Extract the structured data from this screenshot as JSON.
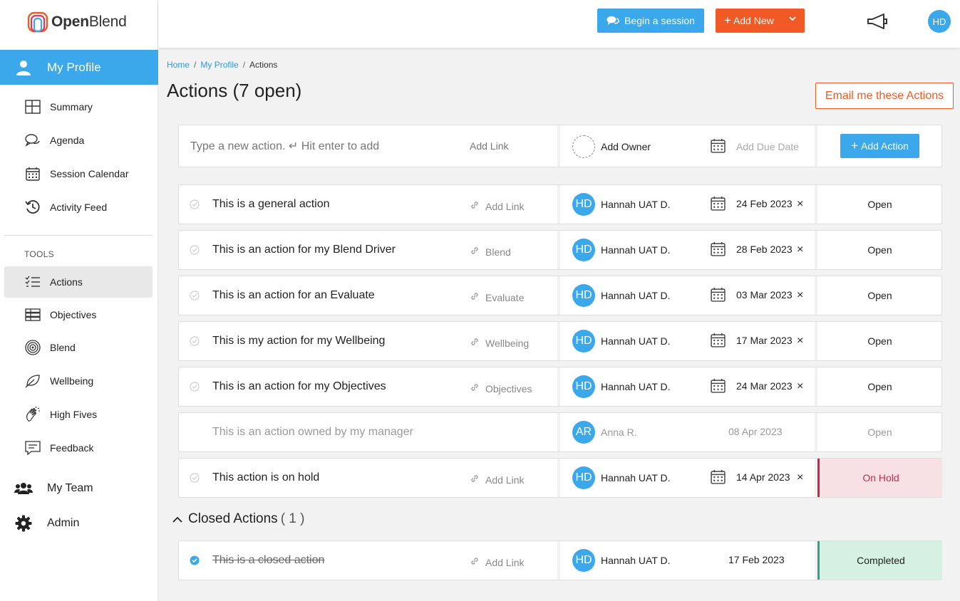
{
  "app": {
    "logo_open": "Open",
    "logo_blend": "Blend"
  },
  "sidebar": {
    "profile_label": "My Profile",
    "items": [
      {
        "label": "Summary",
        "icon": "grid-icon"
      },
      {
        "label": "Agenda",
        "icon": "chat-bubbles-icon"
      },
      {
        "label": "Session Calendar",
        "icon": "calendar-icon"
      },
      {
        "label": "Activity Feed",
        "icon": "history-icon"
      }
    ],
    "tools_label": "TOOLS",
    "tools": [
      {
        "label": "Actions",
        "icon": "checklist-icon",
        "active": true
      },
      {
        "label": "Objectives",
        "icon": "stack-icon"
      },
      {
        "label": "Blend",
        "icon": "target-icon"
      },
      {
        "label": "Wellbeing",
        "icon": "leaf-icon"
      },
      {
        "label": "High Fives",
        "icon": "clap-hands-icon"
      },
      {
        "label": "Feedback",
        "icon": "feedback-icon"
      }
    ],
    "team_label": "My Team",
    "admin_label": "Admin"
  },
  "topbar": {
    "begin_session": "Begin a session",
    "add_new": "Add New",
    "user_initials": "HD"
  },
  "breadcrumb": {
    "home": "Home",
    "profile": "My Profile",
    "current": "Actions",
    "separator": "/"
  },
  "page": {
    "title": "Actions (7 open)",
    "email_button": "Email me these Actions"
  },
  "new_action": {
    "placeholder": "Type a new action. ↵ Hit enter to add",
    "add_link": "Add Link",
    "add_owner": "Add Owner",
    "add_due_date": "Add Due Date",
    "add_action_button": "Add Action"
  },
  "actions": [
    {
      "title": "This is a general action",
      "link": "Add Link",
      "initials": "HD",
      "owner": "Hannah UAT D.",
      "date": "24 Feb 2023",
      "status": "Open"
    },
    {
      "title": "This is an action for my Blend Driver",
      "link": "Blend",
      "initials": "HD",
      "owner": "Hannah UAT D.",
      "date": "28 Feb 2023",
      "status": "Open"
    },
    {
      "title": "This is an action for an Evaluate",
      "link": "Evaluate",
      "initials": "HD",
      "owner": "Hannah UAT D.",
      "date": "03 Mar 2023",
      "status": "Open"
    },
    {
      "title": "This is my action for my Wellbeing",
      "link": "Wellbeing",
      "initials": "HD",
      "owner": "Hannah UAT D.",
      "date": "17 Mar 2023",
      "status": "Open"
    },
    {
      "title": "This is an action for my Objectives",
      "link": "Objectives",
      "initials": "HD",
      "owner": "Hannah UAT D.",
      "date": "24 Mar 2023",
      "status": "Open"
    },
    {
      "title": "This is an action owned by my manager",
      "link": "",
      "initials": "AR",
      "owner": "Anna R.",
      "date": "08 Apr 2023",
      "status": "Open"
    },
    {
      "title": "This action is on hold",
      "link": "Add Link",
      "initials": "HD",
      "owner": "Hannah UAT D.",
      "date": "14 Apr 2023",
      "status": "On Hold"
    }
  ],
  "closed": {
    "label": "Closed Actions",
    "count": "( 1 )",
    "items": [
      {
        "title": "This is a closed action",
        "link": "Add Link",
        "initials": "HD",
        "owner": "Hannah UAT D.",
        "date": "17 Feb 2023",
        "status": "Completed"
      }
    ]
  },
  "colors": {
    "primary": "#3aa8ea",
    "accent": "#f15a24",
    "on_hold": "#d4234a",
    "completed": "#2aa58a"
  }
}
